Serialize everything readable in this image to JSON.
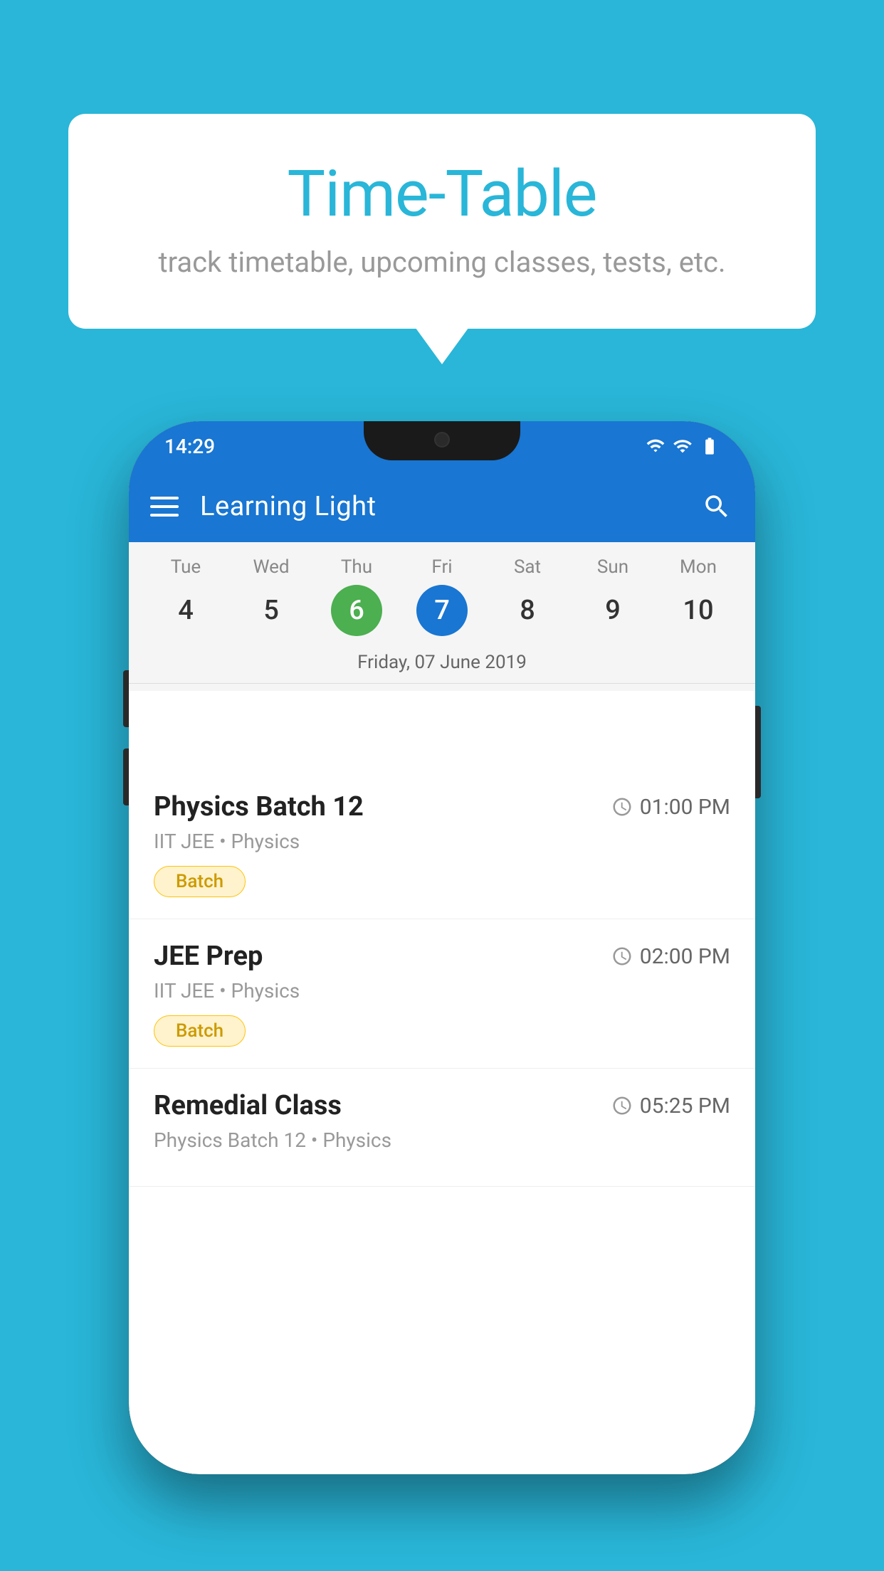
{
  "page": {
    "bg_color": "#29B6D8"
  },
  "speech_bubble": {
    "title": "Time-Table",
    "subtitle": "track timetable, upcoming classes, tests, etc."
  },
  "app_bar": {
    "title": "Learning Light",
    "search_label": "search"
  },
  "status_bar": {
    "time": "14:29"
  },
  "calendar": {
    "days": [
      {
        "name": "Tue",
        "number": "4",
        "state": "normal"
      },
      {
        "name": "Wed",
        "number": "5",
        "state": "normal"
      },
      {
        "name": "Thu",
        "number": "6",
        "state": "today"
      },
      {
        "name": "Fri",
        "number": "7",
        "state": "selected"
      },
      {
        "name": "Sat",
        "number": "8",
        "state": "normal"
      },
      {
        "name": "Sun",
        "number": "9",
        "state": "normal"
      },
      {
        "name": "Mon",
        "number": "10",
        "state": "normal"
      }
    ],
    "selected_date_label": "Friday, 07 June 2019"
  },
  "schedule": {
    "items": [
      {
        "title": "Physics Batch 12",
        "time": "01:00 PM",
        "subtitle": "IIT JEE • Physics",
        "badge": "Batch"
      },
      {
        "title": "JEE Prep",
        "time": "02:00 PM",
        "subtitle": "IIT JEE • Physics",
        "badge": "Batch"
      },
      {
        "title": "Remedial Class",
        "time": "05:25 PM",
        "subtitle": "Physics Batch 12 • Physics",
        "badge": null
      }
    ]
  }
}
